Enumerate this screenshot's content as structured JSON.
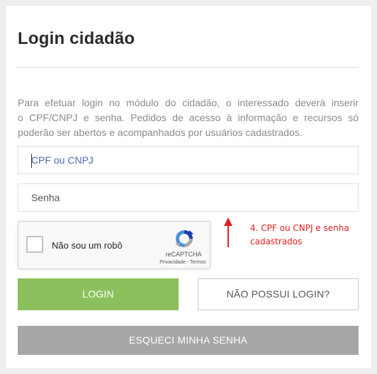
{
  "login": {
    "title": "Login cidadão",
    "intro_line1": "Para efetuar login no módulo do cidadão, o interessado deverá inserir",
    "intro_line2": "o CPF/CNPJ e senha. Pedidos de acesso à informação e recursos só",
    "intro_line3": "poderão ser abertos e acompanhados por usuários cadastrados.",
    "cpf_placeholder": "CPF ou CNPJ",
    "senha_placeholder": "Senha",
    "login_button": "LOGIN",
    "no_login_button": "NÃO POSSUI LOGIN?",
    "forgot_button": "ESQUECI MINHA SENHA"
  },
  "recaptcha": {
    "label": "Não sou um robô",
    "brand": "reCAPTCHA",
    "links": "Privacidade - Termos",
    "logo_icon": "recaptcha-logo-icon"
  },
  "annotation": {
    "line1": "4. CPF ou CNPJ e senha",
    "line2": "cadastrados",
    "color": "#e02020",
    "icon": "up-arrow-icon"
  },
  "colors": {
    "login_button": "#8cc05d",
    "forgot_button": "#a6a6a6",
    "placeholder_active": "#4a6fb0"
  }
}
